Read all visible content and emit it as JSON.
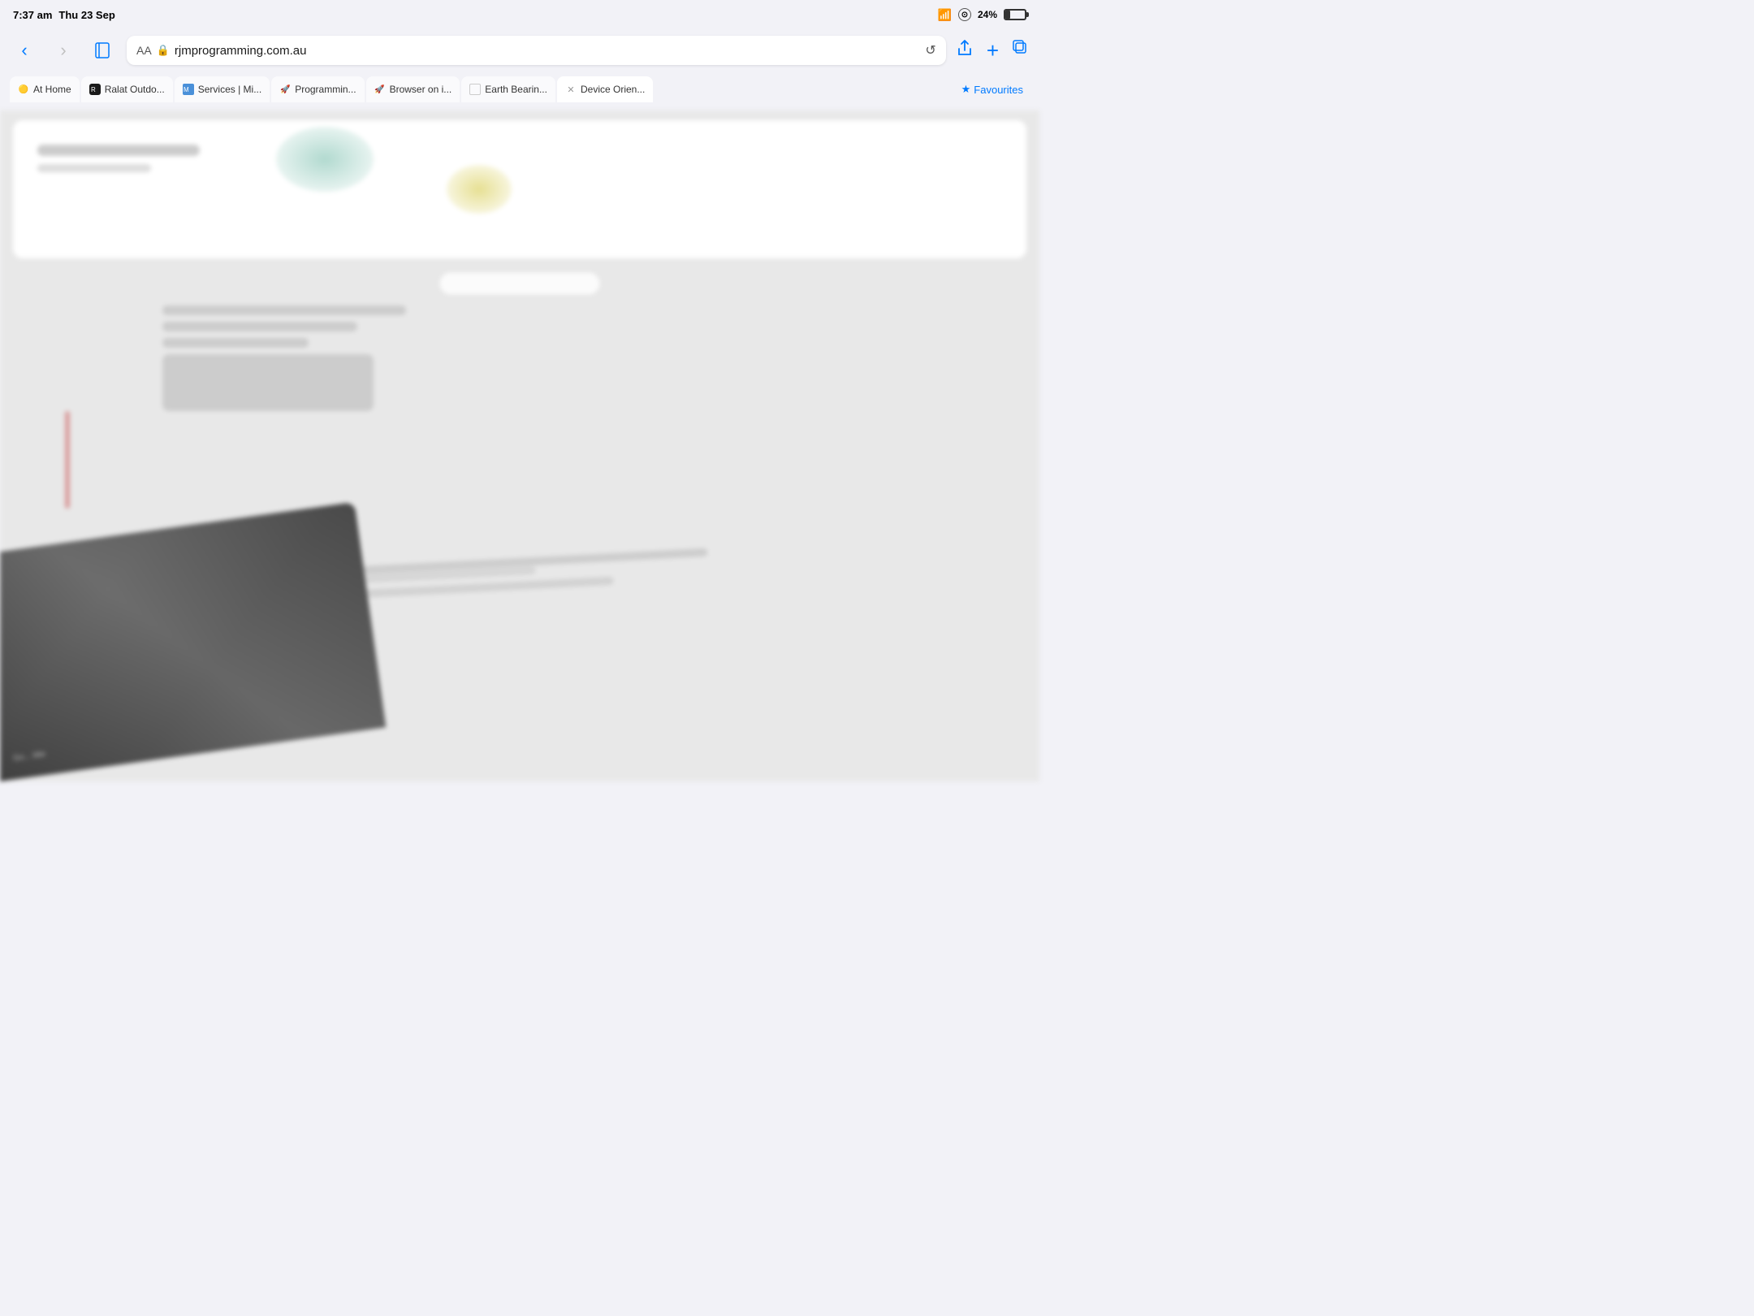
{
  "status": {
    "time": "7:37 am",
    "day": "Thu 23 Sep",
    "wifi": "wifi",
    "signal": "signal",
    "battery_percent": "24%"
  },
  "browser": {
    "url": "rjmprogramming.com.au",
    "back_label": "‹",
    "forward_label": "›",
    "reload_label": "↺",
    "share_label": "↑",
    "new_tab_label": "+",
    "tabs_label": "⧉"
  },
  "tabs": [
    {
      "id": "tab1",
      "label": "At Home",
      "favicon": "🟡",
      "active": false,
      "closeable": false
    },
    {
      "id": "tab2",
      "label": "Ralat Outdo...",
      "favicon": "🟢",
      "active": false,
      "closeable": false
    },
    {
      "id": "tab3",
      "label": "Services | Mi...",
      "favicon": "📋",
      "active": false,
      "closeable": false
    },
    {
      "id": "tab4",
      "label": "Programmin...",
      "favicon": "🚀",
      "active": false,
      "closeable": false
    },
    {
      "id": "tab5",
      "label": "Browser on i...",
      "favicon": "🚀",
      "active": false,
      "closeable": false
    },
    {
      "id": "tab6",
      "label": "Earth Bearin...",
      "favicon": "⬜",
      "active": false,
      "closeable": false
    },
    {
      "id": "tab7",
      "label": "Device Orien...",
      "favicon": "✕",
      "active": true,
      "closeable": true
    },
    {
      "id": "tab8",
      "label": "Favourites",
      "favicon": "★",
      "active": false,
      "closeable": false
    }
  ],
  "aa_label": "AA"
}
